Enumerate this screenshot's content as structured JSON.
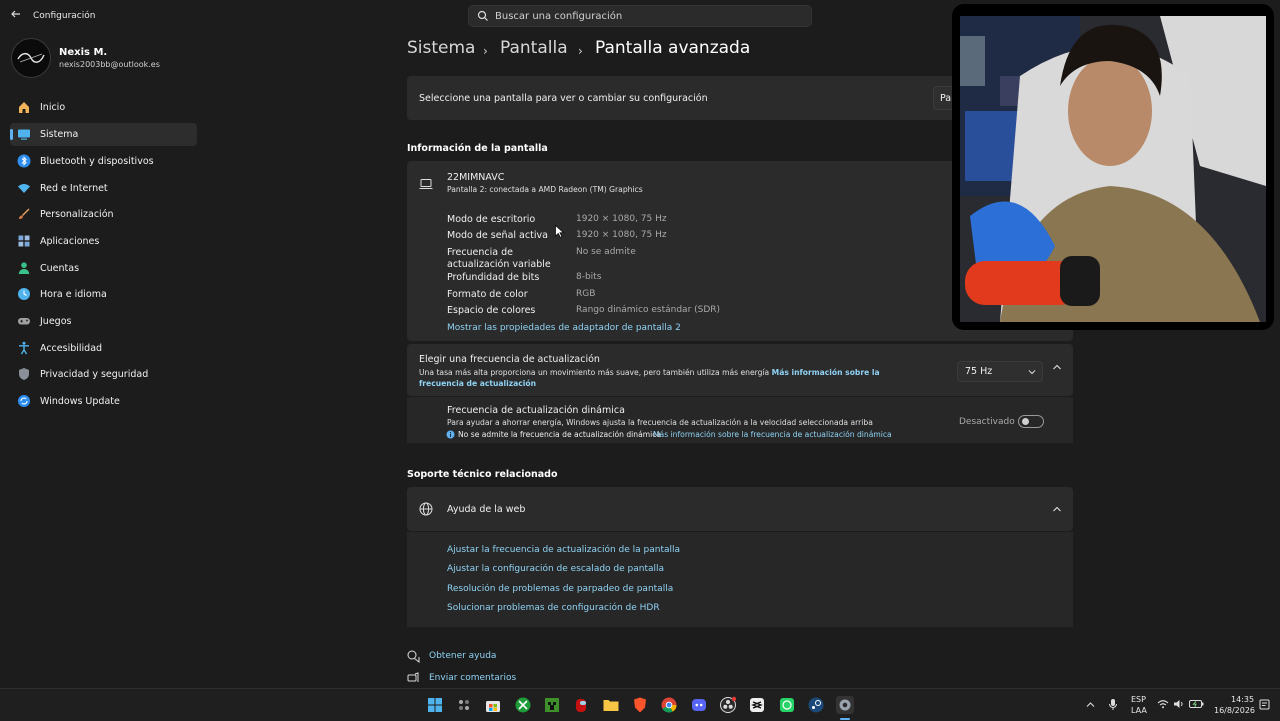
{
  "app": {
    "title": "Configuración",
    "search_placeholder": "Buscar una configuración"
  },
  "user": {
    "name": "Nexis M.",
    "email": "nexis2003bb@outlook.es"
  },
  "nav": {
    "items": [
      {
        "label": "Inicio",
        "icon": "home-icon",
        "color": "#f2b45a"
      },
      {
        "label": "Sistema",
        "icon": "monitor-icon",
        "color": "#4fb3ee",
        "selected": true
      },
      {
        "label": "Bluetooth y dispositivos",
        "icon": "bluetooth-icon",
        "color": "#2d8ef0"
      },
      {
        "label": "Red e Internet",
        "icon": "wifi-icon",
        "color": "#4fb3ee"
      },
      {
        "label": "Personalización",
        "icon": "brush-icon",
        "color": "#e8a060"
      },
      {
        "label": "Aplicaciones",
        "icon": "apps-icon",
        "color": "#7aa7d9"
      },
      {
        "label": "Cuentas",
        "icon": "person-icon",
        "color": "#3cc08a"
      },
      {
        "label": "Hora e idioma",
        "icon": "globe-clock-icon",
        "color": "#4fb3ee"
      },
      {
        "label": "Juegos",
        "icon": "gamepad-icon",
        "color": "#a0a0a0"
      },
      {
        "label": "Accesibilidad",
        "icon": "accessibility-icon",
        "color": "#4fb3ee"
      },
      {
        "label": "Privacidad y seguridad",
        "icon": "shield-icon",
        "color": "#8a8f99"
      },
      {
        "label": "Windows Update",
        "icon": "update-icon",
        "color": "#2d8ef0"
      }
    ]
  },
  "breadcrumb": {
    "parts": [
      "Sistema",
      "Pantalla"
    ],
    "current": "Pantalla avanzada"
  },
  "select_display": {
    "label": "Seleccione una pantalla para ver o cambiar su configuración",
    "value_partial": "Pan"
  },
  "display_info": {
    "section_title": "Información de la pantalla",
    "monitor_name": "22MIMNAVC",
    "monitor_subtitle": "Pantalla 2: conectada a AMD Radeon (TM) Graphics",
    "rows": [
      {
        "label": "Modo de escritorio",
        "value": "1920 × 1080, 75 Hz"
      },
      {
        "label": "Modo de señal activa",
        "value": "1920 × 1080, 75 Hz"
      },
      {
        "label": "Frecuencia de actualización variable",
        "value": "No se admite"
      },
      {
        "label": "Profundidad de bits",
        "value": "8-bits"
      },
      {
        "label": "Formato de color",
        "value": "RGB"
      },
      {
        "label": "Espacio de colores",
        "value": "Rango dinámico estándar (SDR)"
      }
    ],
    "adapter_link": "Mostrar las propiedades de adaptador de pantalla 2"
  },
  "refresh_rate": {
    "title": "Elegir una frecuencia de actualización",
    "description": "Una tasa más alta proporciona un movimiento más suave, pero también utiliza más energía",
    "more_info_link": "Más información sobre la frecuencia de actualización",
    "selected": "75 Hz",
    "dynamic": {
      "title": "Frecuencia de actualización dinámica",
      "description": "Para ayudar a ahorrar energía, Windows ajusta la frecuencia de actualización a la velocidad seleccionada arriba",
      "warning": "No se admite la frecuencia de actualización dinámica",
      "warning_link": "Más información sobre la frecuencia de actualización dinámica",
      "toggle_label": "Desactivado",
      "toggle_on": false
    }
  },
  "support": {
    "section_title": "Soporte técnico relacionado",
    "web_help_title": "Ayuda de la web",
    "links": [
      "Ajustar la frecuencia de actualización de la pantalla",
      "Ajustar la configuración de escalado de pantalla",
      "Resolución de problemas de parpadeo de pantalla",
      "Solucionar problemas de configuración de HDR"
    ]
  },
  "footer_links": {
    "get_help": "Obtener ayuda",
    "feedback": "Enviar comentarios"
  },
  "taskbar": {
    "apps": [
      "start-icon",
      "widgets-icon",
      "store-icon",
      "xbox-icon",
      "minecraft-icon",
      "among-us-icon",
      "file-explorer-icon",
      "brave-icon",
      "chrome-icon",
      "discord-icon",
      "obs-icon",
      "capcut-icon",
      "whatsapp-icon",
      "steam-icon",
      "settings-icon"
    ],
    "language": "ESP",
    "layout": "LAA",
    "time": "14:35",
    "date": "16/8/2026"
  },
  "colors": {
    "accent": "#5fb2f2",
    "link": "#8fd3f5",
    "background": "#1c1c1c",
    "card": "#2b2b2b"
  }
}
